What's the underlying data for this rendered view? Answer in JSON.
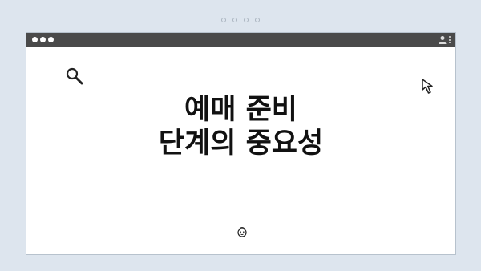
{
  "headline": {
    "line1": "예매 준비",
    "line2": "단계의 중요성"
  },
  "icons": {
    "search": "search-icon",
    "cursor": "cursor-icon",
    "user": "user-icon",
    "menu": "kebab-menu-icon",
    "face": "face-icon"
  },
  "colors": {
    "background": "#dde5ee",
    "titlebar": "#4a4a4a",
    "text": "#111111"
  }
}
